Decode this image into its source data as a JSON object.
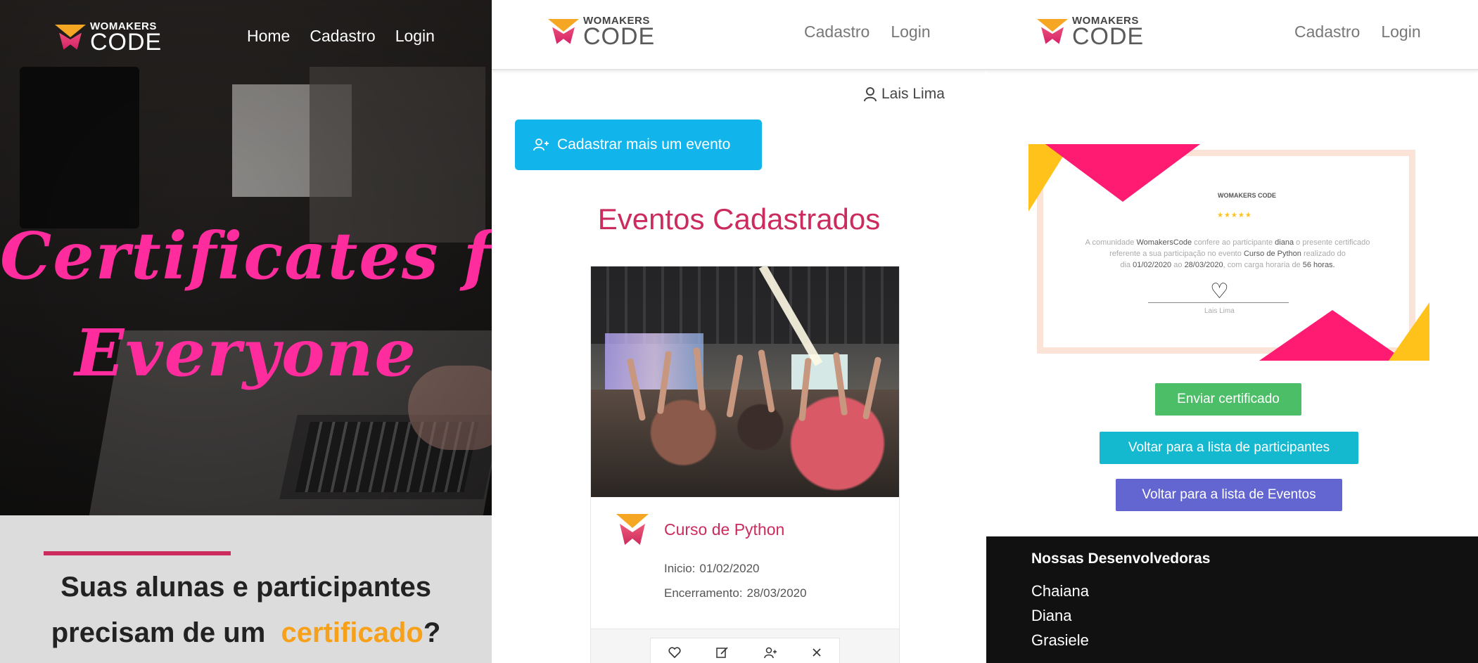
{
  "brand": {
    "logo_top": "WOMAKERS",
    "logo_bottom": "CODE"
  },
  "panel1": {
    "nav": [
      "Home",
      "Cadastro",
      "Login"
    ],
    "hero_line1": "Certificates for",
    "hero_line2": "Everyone",
    "question_line1": "Suas alunas e participantes",
    "question_line2_pre": "precisam de um",
    "question_highlight": "certificado",
    "question_end": "?"
  },
  "panel2": {
    "nav": [
      "Cadastro",
      "Login"
    ],
    "user_name": "Lais Lima",
    "add_event_label": "Cadastrar mais um evento",
    "section_title": "Eventos Cadastrados",
    "event": {
      "title": "Curso de Python",
      "start_label": "Inicio:",
      "start_date": "01/02/2020",
      "end_label": "Encerramento:",
      "end_date": "28/03/2020"
    },
    "card_actions": [
      "heart-icon",
      "edit-icon",
      "participants-icon",
      "close-icon"
    ]
  },
  "panel3": {
    "nav": [
      "Cadastro",
      "Login"
    ],
    "certificate": {
      "logo": "WOMAKERS CODE",
      "stars": "★★★★★",
      "line1_a": "A comunidade",
      "line1_b": "WomakersCode",
      "line1_c": "confere ao participante",
      "line1_d": "diana",
      "line1_e": "o presente certificado",
      "line2_a": "referente a sua participação no evento",
      "line2_b": "Curso de Python",
      "line2_c": "realizado do",
      "line3_a": "dia",
      "line3_b": "01/02/2020",
      "line3_c": "ao",
      "line3_d": "28/03/2020",
      "line3_e": ", com carga horaria de",
      "line3_f": "56 horas.",
      "signature_name": "Lais Lima"
    },
    "send_label": "Enviar certificado",
    "back_participants_label": "Voltar para a lista de participantes",
    "back_events_label": "Voltar para a lista de Eventos",
    "devs_title": "Nossas Desenvolvedoras",
    "devs": [
      "Chaiana",
      "Diana",
      "Grasiele"
    ]
  },
  "colors": {
    "pink": "#cc2b5e",
    "hero_pink": "#ff2c9d",
    "highlight_orange": "#f7a11a",
    "blue_button": "#11b5eb",
    "green_button": "#4cbe67",
    "cyan_button": "#14b9d0",
    "purple_button": "#6366d1"
  }
}
